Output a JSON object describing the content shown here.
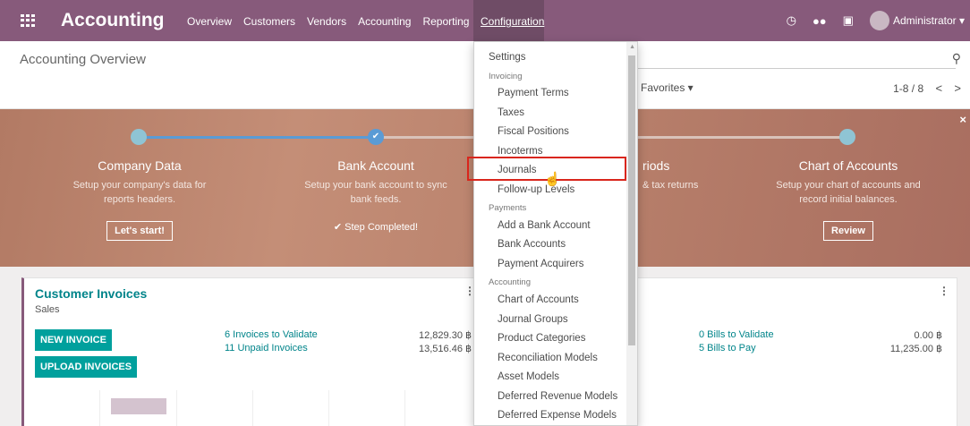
{
  "navbar": {
    "app_title": "Accounting",
    "menu": [
      "Overview",
      "Customers",
      "Vendors",
      "Accounting",
      "Reporting"
    ],
    "active_menu": "Configuration",
    "user": "Administrator ▾",
    "icons": [
      "apps-grid-icon",
      "clock-icon",
      "chat-icon",
      "gift-icon",
      "avatar"
    ]
  },
  "control": {
    "title": "Accounting Overview",
    "favorites": "Favorites ▾",
    "pager": "1-8 / 8",
    "prev": "<",
    "next": ">"
  },
  "banner": {
    "close": "×",
    "steps": [
      {
        "title": "Company Data",
        "desc": "Setup your company's data for reports headers.",
        "action": "Let's start!"
      },
      {
        "title": "Bank Account",
        "desc": "Setup your bank account to sync bank feeds.",
        "action": "✔ Step Completed!"
      },
      {
        "title": "riods",
        "desc": "& tax returns",
        "action": ""
      },
      {
        "title": "Chart of Accounts",
        "desc": "Setup your chart of accounts and record initial balances.",
        "action": "Review"
      }
    ]
  },
  "customer_card": {
    "title": "Customer Invoices",
    "subtitle": "Sales",
    "new_invoice": "NEW INVOICE",
    "upload_invoices": "UPLOAD INVOICES",
    "link1": "6 Invoices to Validate",
    "amount1": "12,829.30 ฿",
    "link2": "11 Unpaid Invoices",
    "amount2": "13,516.46 ฿",
    "menu_icon": "⋮"
  },
  "vendor_card": {
    "link1": "0 Bills to Validate",
    "amount1": "0.00 ฿",
    "link2": "5 Bills to Pay",
    "amount2": "11,235.00 ฿",
    "menu_icon": "⋮"
  },
  "dropdown": {
    "settings": "Settings",
    "invoicing_header": "Invoicing",
    "invoicing": [
      "Payment Terms",
      "Taxes",
      "Fiscal Positions",
      "Incoterms",
      "Journals",
      "Follow-up Levels"
    ],
    "payments_header": "Payments",
    "payments": [
      "Add a Bank Account",
      "Bank Accounts",
      "Payment Acquirers"
    ],
    "accounting_header": "Accounting",
    "accounting": [
      "Chart of Accounts",
      "Journal Groups",
      "Product Categories",
      "Reconciliation Models",
      "Asset Models",
      "Deferred Revenue Models",
      "Deferred Expense Models"
    ]
  },
  "colors": {
    "brand": "#875a7b",
    "teal": "#00a09d",
    "highlight": "#d9261c"
  }
}
